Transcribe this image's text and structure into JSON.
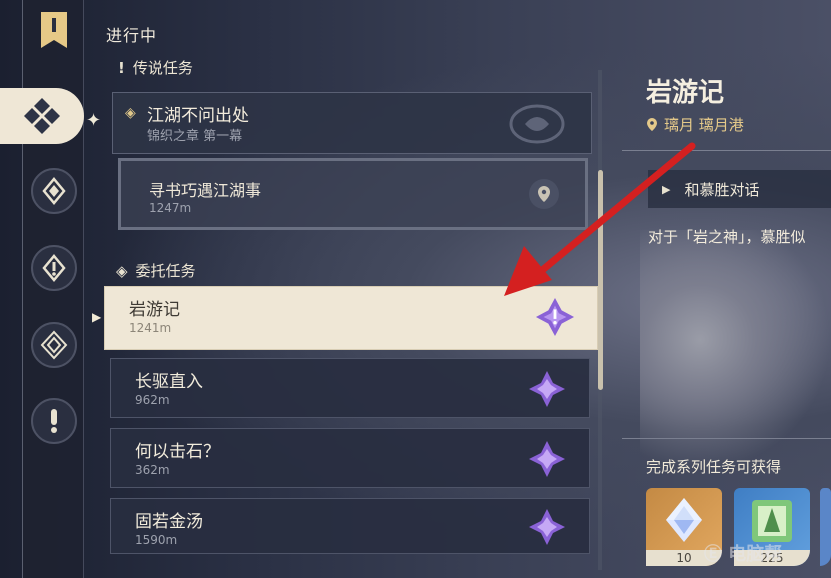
{
  "header": {
    "in_progress": "进行中"
  },
  "sections": {
    "legend": "传说任务",
    "commission": "委托任务"
  },
  "legend_quest": {
    "title": "江湖不问出处",
    "subtitle": "锦织之章 第一幕",
    "sub_step": {
      "title": "寻书巧遇江湖事",
      "distance": "1247m"
    }
  },
  "quests": [
    {
      "title": "岩游记",
      "distance": "1241m",
      "selected": true
    },
    {
      "title": "长驱直入",
      "distance": "962m",
      "selected": false
    },
    {
      "title": "何以击石？",
      "distance": "362m",
      "selected": false
    },
    {
      "title": "固若金汤",
      "distance": "1590m",
      "selected": false
    }
  ],
  "detail": {
    "title": "岩游记",
    "location": "璃月 璃月港",
    "step": "和慕胜对话",
    "description": "对于「岩之神」，慕胜似",
    "reward_label": "完成系列任务可获得",
    "rewards": [
      {
        "name": "primogem",
        "count": "10"
      },
      {
        "name": "adventure-exp",
        "count": "225"
      }
    ]
  },
  "watermark": "电脑帮",
  "colors": {
    "accent_gold": "#e4c98a",
    "selected_bg": "#efe7d6",
    "arrow_red": "#d42020",
    "quest_purple": "#8a62d6"
  }
}
